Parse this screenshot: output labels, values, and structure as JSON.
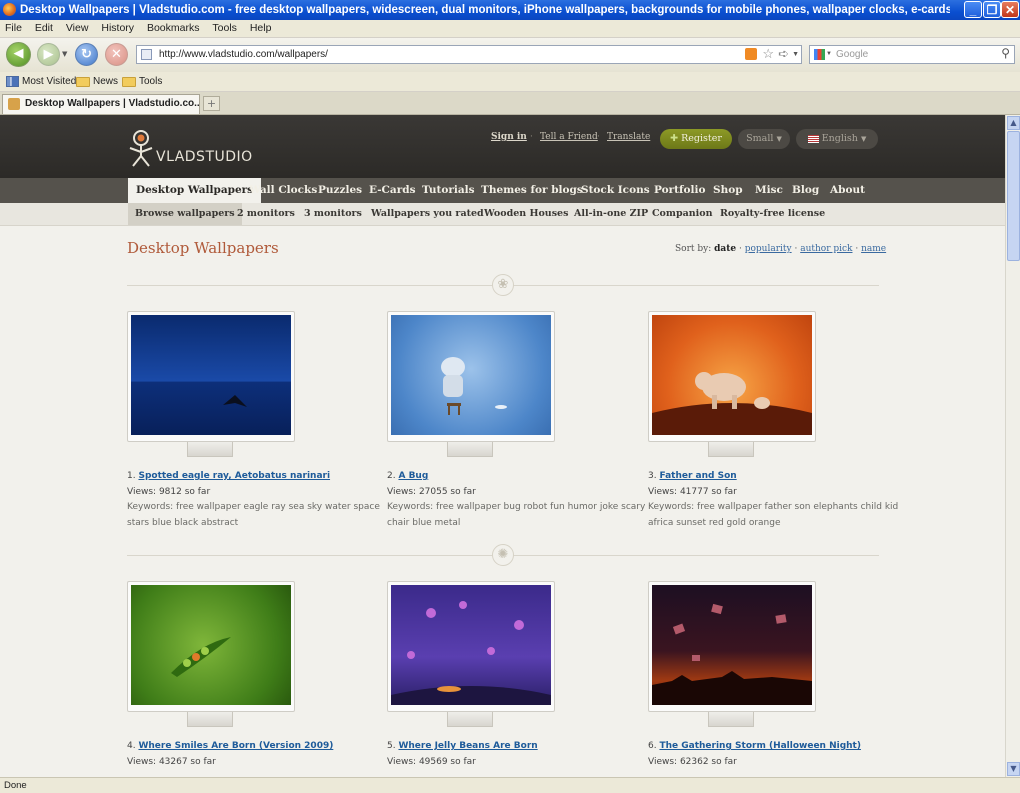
{
  "window": {
    "title": "Desktop Wallpapers | Vladstudio.com - free desktop wallpapers, widescreen, dual monitors, iPhone wallpapers, backgrounds for mobile phones, wallpaper clocks, e-cards - Mozilla Firefox"
  },
  "menu": [
    "File",
    "Edit",
    "View",
    "History",
    "Bookmarks",
    "Tools",
    "Help"
  ],
  "nav": {
    "url": "http://www.vladstudio.com/wallpapers/",
    "search_placeholder": "Google"
  },
  "bookmarks": [
    "Most Visited",
    "News",
    "Tools"
  ],
  "tab": {
    "label": "Desktop Wallpapers | Vladstudio.co..."
  },
  "site": {
    "brand": "VLADSTUDIO",
    "top_links": [
      "Sign in",
      "Tell a Friend",
      "Translate"
    ],
    "register": "Register",
    "size": "Small",
    "language": "English",
    "main_nav": [
      "Desktop Wallpapers",
      "Wall Clocks",
      "Puzzles",
      "E-Cards",
      "Tutorials",
      "Themes for blogs",
      "Stock Icons",
      "Portfolio",
      "Shop",
      "Misc",
      "Blog",
      "About"
    ],
    "sub_nav": [
      "Browse wallpapers",
      "2 monitors",
      "3 monitors",
      "Wallpapers you rated",
      "Wooden Houses",
      "All-in-one ZIP",
      "Companion",
      "Royalty-free license"
    ]
  },
  "content": {
    "title": "Desktop Wallpapers",
    "sort_label": "Sort by:",
    "sort_current": "date",
    "sort_options": [
      "popularity",
      "author pick",
      "name"
    ],
    "wallpapers": [
      {
        "num": "1.",
        "title": "Spotted eagle ray, Aetobatus narinari",
        "views": "Views: 9812 so far",
        "keywords": "Keywords: free wallpaper eagle ray sea sky water space stars blue black abstract"
      },
      {
        "num": "2.",
        "title": "A Bug",
        "views": "Views: 27055 so far",
        "keywords": "Keywords: free wallpaper bug robot fun humor joke scary chair blue metal"
      },
      {
        "num": "3.",
        "title": "Father and Son",
        "views": "Views: 41777 so far",
        "keywords": "Keywords: free wallpaper father son elephants child kid africa sunset red gold orange"
      },
      {
        "num": "4.",
        "title": "Where Smiles Are Born (Version 2009)",
        "views": "Views: 43267 so far",
        "keywords": ""
      },
      {
        "num": "5.",
        "title": "Where Jelly Beans Are Born",
        "views": "Views: 49569 so far",
        "keywords": ""
      },
      {
        "num": "6.",
        "title": "The Gathering Storm (Halloween Night)",
        "views": "Views: 62362 so far",
        "keywords": ""
      }
    ]
  },
  "status": "Done"
}
